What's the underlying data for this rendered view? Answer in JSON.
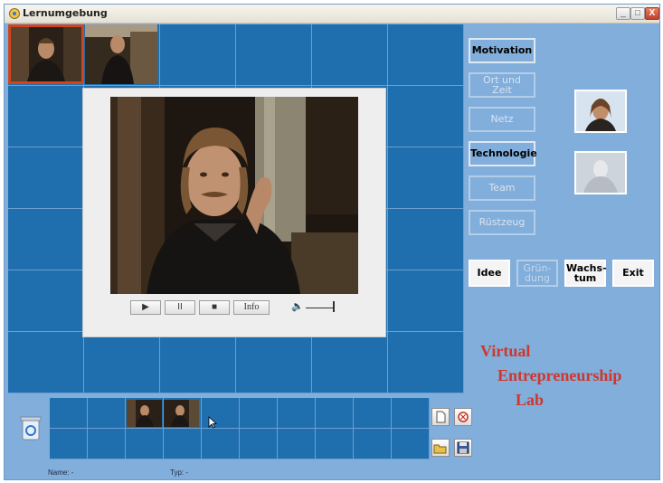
{
  "window": {
    "title": "Lernumgebung",
    "minimize_glyph": "_",
    "maximize_glyph": "□",
    "close_glyph": "X"
  },
  "player": {
    "play_glyph": "▶",
    "pause_glyph": "II",
    "stop_glyph": "■",
    "info_label": "Info",
    "volume_glyph": "🔈"
  },
  "topics": [
    {
      "label": "Motivation",
      "enabled": true
    },
    {
      "label": "Ort und Zeit",
      "enabled": false
    },
    {
      "label": "Netz",
      "enabled": false
    },
    {
      "label": "Technologie",
      "enabled": true
    },
    {
      "label": "Team",
      "enabled": false
    },
    {
      "label": "Rüstzeug",
      "enabled": false
    }
  ],
  "phases": [
    {
      "label": "Idee",
      "enabled": true
    },
    {
      "label": "Grün- dung",
      "enabled": false
    },
    {
      "label": "Wachs- tum",
      "enabled": true
    },
    {
      "label": "Exit",
      "enabled": true
    }
  ],
  "lab_title": [
    "Virtual",
    "Entrepreneurship",
    "Lab"
  ],
  "status": {
    "name": "Name: -",
    "type": "Typ: -"
  },
  "icons": {
    "app": "app-icon",
    "recycle": "recycle-bin-icon",
    "new": "new-document-icon",
    "delete": "delete-icon",
    "open": "open-folder-icon",
    "save": "save-disk-icon",
    "cursor": "mouse-cursor-icon"
  },
  "colors": {
    "background": "#82aedb",
    "grid_cell": "#1f6fae",
    "selection": "#d1441e",
    "lab_title": "#d0362b"
  }
}
